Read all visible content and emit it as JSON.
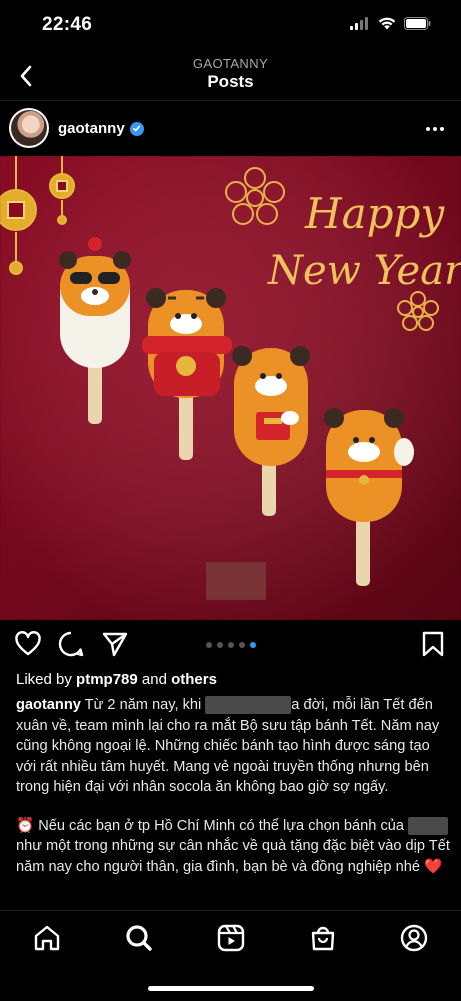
{
  "status_bar": {
    "time": "22:46"
  },
  "nav": {
    "subtitle": "GAOTANNY",
    "title": "Posts"
  },
  "post": {
    "username": "gaotanny",
    "image": {
      "greeting_line1": "Happy",
      "greeting_line2": "New Year",
      "carousel_count": 5,
      "carousel_active_index": 4
    },
    "likes_prefix": "Liked by ",
    "likes_user": "ptmp789",
    "likes_middle": " and ",
    "likes_suffix": "others",
    "caption_user": "gaotanny",
    "caption_p1_a": " Từ 2 năm nay, khi ",
    "caption_p1_b": "a đời, mỗi lần Tết đến xuân về, team mình lại cho ra mắt Bộ sưu tập bánh Tết. Năm nay cũng không ngoại lệ. Những chiếc bánh tạo hình được sáng tạo với rất nhiều tâm huyết. Mang vẻ ngoài truyền thống nhưng bên trong hiện đại với nhân socola ăn không bao giờ sợ ngấy.",
    "caption_p2_icon": "⏰",
    "caption_p2_a": " Nếu các bạn ở tp Hồ Chí Minh có thể lựa chọn bánh của ",
    "caption_p2_b": " như một trong những sự cân nhắc về quà tặng đặc biệt vào dịp Tết năm nay cho người thân, gia đình, bạn bè và đồng nghiệp nhé ",
    "caption_p2_heart": "❤️"
  },
  "icons": {
    "back": "chevron-left-icon",
    "more": "more-horizontal-icon",
    "like": "heart-icon",
    "comment": "comment-icon",
    "share": "send-icon",
    "save": "bookmark-icon",
    "tabs": [
      "home-icon",
      "search-icon",
      "reels-icon",
      "shop-icon",
      "profile-icon"
    ]
  },
  "colors": {
    "background": "#000000",
    "accent": "#3897f0",
    "image_bg": "#8d0b24"
  }
}
